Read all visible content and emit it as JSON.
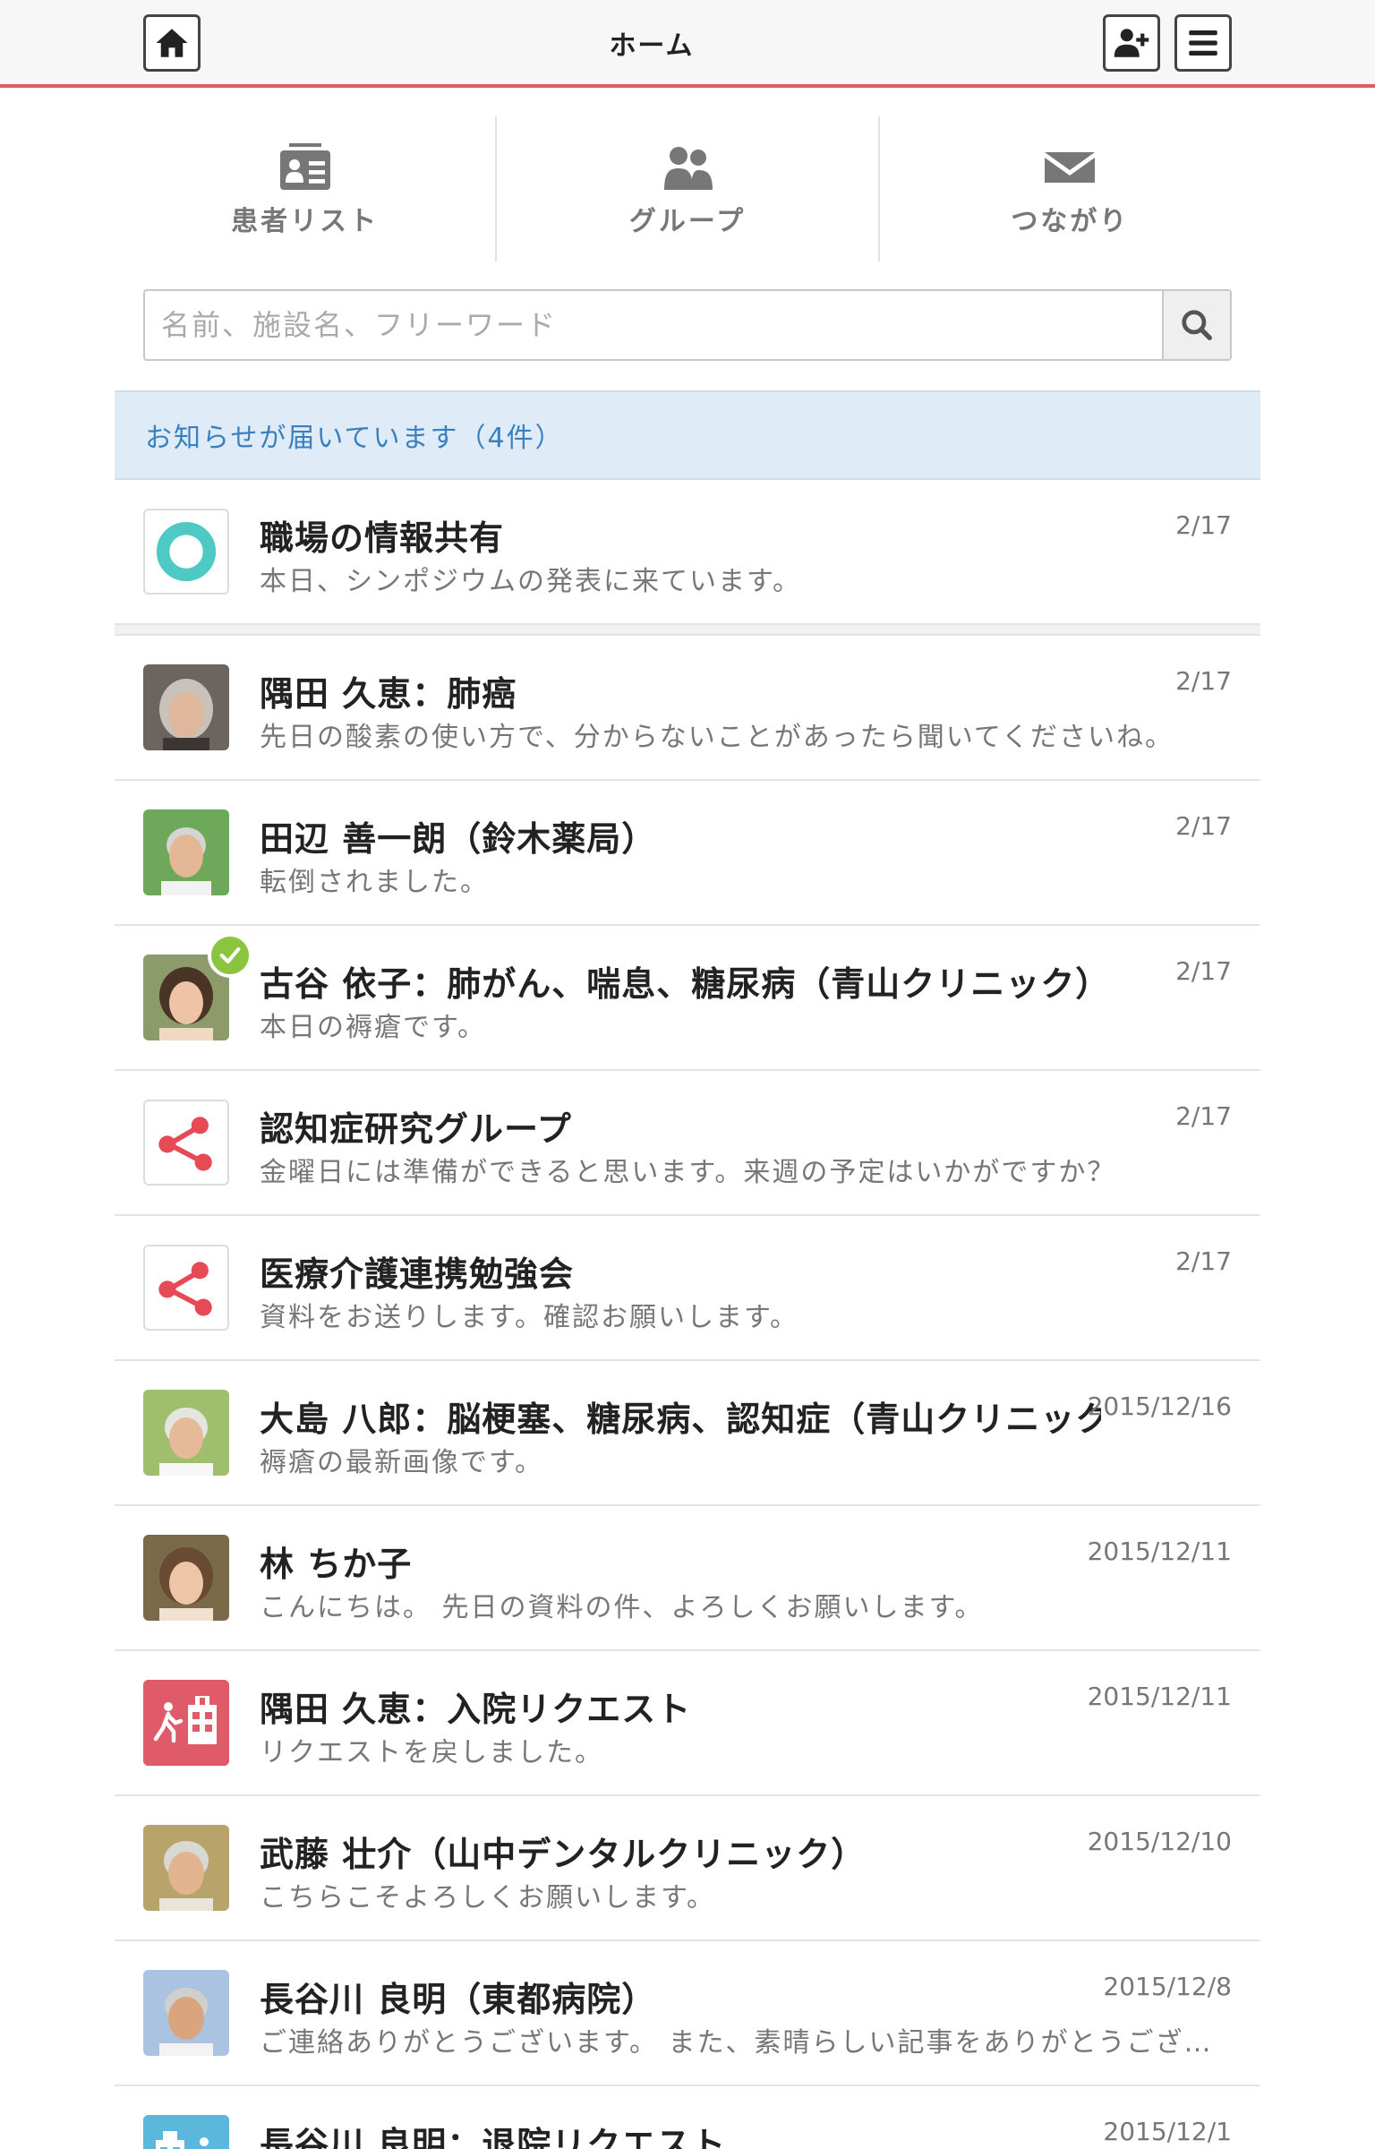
{
  "header": {
    "title": "ホーム"
  },
  "tabs": [
    {
      "label": "患者リスト",
      "icon": "id-card-icon"
    },
    {
      "label": "グループ",
      "icon": "group-icon"
    },
    {
      "label": "つながり",
      "icon": "envelope-icon"
    }
  ],
  "search": {
    "placeholder": "名前、施設名、フリーワード"
  },
  "notice": {
    "text": "お知らせが届いています（4件）"
  },
  "items": [
    {
      "title": "職場の情報共有",
      "message": "本日、シンポジウムの発表に来ています。",
      "date": "2/17",
      "avatar": "ring-logo"
    },
    {
      "title": "隅田 久恵：肺癌",
      "message": "先日の酸素の使い方で、分からないことがあったら聞いてくださいね。",
      "date": "2/17",
      "avatar": "patient-photo"
    },
    {
      "title": "田辺 善一朗（鈴木薬局）",
      "message": "転倒されました。",
      "date": "2/17",
      "avatar": "patient-photo"
    },
    {
      "title": "古谷 依子：肺がん、喘息、糖尿病（青山クリニック）",
      "message": "本日の褥瘡です。",
      "date": "2/17",
      "avatar": "patient-photo",
      "checked": true
    },
    {
      "title": "認知症研究グループ",
      "message": "金曜日には準備ができると思います。来週の予定はいかがですか？",
      "date": "2/17",
      "avatar": "group-share-icon"
    },
    {
      "title": "医療介護連携勉強会",
      "message": "資料をお送りします。確認お願いします。",
      "date": "2/17",
      "avatar": "group-share-icon"
    },
    {
      "title": "大島 八郎：脳梗塞、糖尿病、認知症（青山クリニック）",
      "message": "褥瘡の最新画像です。",
      "date": "2015/12/16",
      "avatar": "patient-photo"
    },
    {
      "title": "林 ちか子",
      "message": "こんにちは。 先日の資料の件、よろしくお願いします。",
      "date": "2015/12/11",
      "avatar": "patient-photo"
    },
    {
      "title": "隅田 久恵：入院リクエスト",
      "message": "リクエストを戻しました。",
      "date": "2015/12/11",
      "avatar": "hospital-admission-icon"
    },
    {
      "title": "武藤 壮介（山中デンタルクリニック）",
      "message": "こちらこそよろしくお願いします。",
      "date": "2015/12/10",
      "avatar": "patient-photo"
    },
    {
      "title": "長谷川 良明（東都病院）",
      "message": "ご連絡ありがとうございます。 また、素晴らしい記事をありがとうござ…",
      "date": "2015/12/8",
      "avatar": "patient-photo"
    },
    {
      "title": "長谷川 良明：退院リクエスト",
      "message": "",
      "date": "2015/12/1",
      "avatar": "hospital-discharge-icon"
    }
  ],
  "colors": {
    "accent": "#e05b62",
    "notice_bg": "#dfecf7",
    "notice_text": "#3a7fbf",
    "check": "#8bc53f",
    "ring": "#4ec9c4",
    "share": "#e84a55"
  }
}
